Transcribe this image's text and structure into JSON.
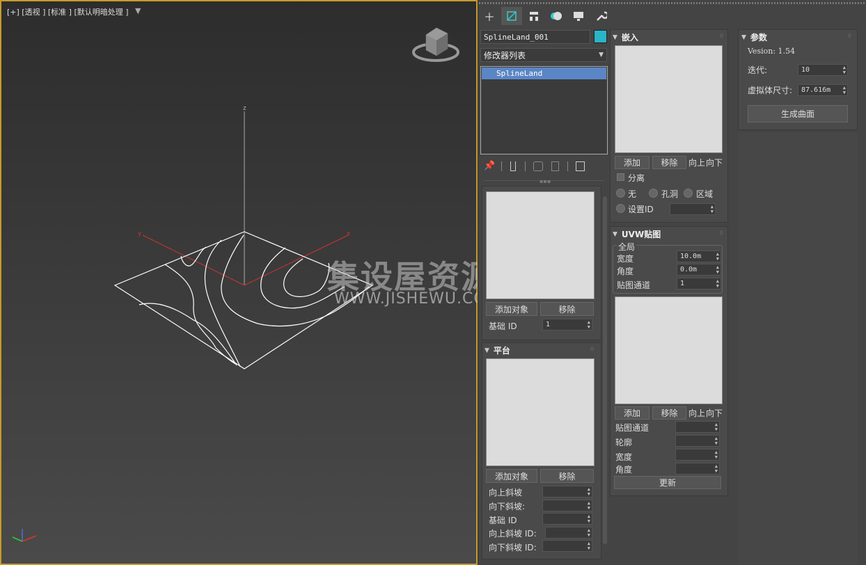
{
  "viewport": {
    "label": "[+] [透视 ] [标准 ] [默认明暗处理 ]",
    "axis_z": "z",
    "axis_x": "x",
    "axis_y": "y",
    "watermark_cn": "集设屋资源网",
    "watermark_en": "WWW.JISHEWU.COM"
  },
  "panel": {
    "object_name": "SplineLand_001",
    "object_color": "#2ab4c8",
    "modifier_dropdown": "修改器列表",
    "modifier_stack": [
      "SplineLand"
    ],
    "tabs": [
      "create-tab",
      "modify-tab",
      "hierarchy-tab",
      "motion-tab",
      "display-tab",
      "utilities-tab"
    ]
  },
  "left_col": {
    "add_object": "添加对象",
    "remove": "移除",
    "base_id_label": "基础 ID",
    "base_id_value": "1"
  },
  "platform": {
    "title": "平台",
    "add_object": "添加对象",
    "remove": "移除",
    "rows": [
      "向上斜坡",
      "向下斜坡:",
      "基础 ID",
      "向上斜坡 ID:",
      "向下斜坡 ID:"
    ]
  },
  "embed": {
    "title": "嵌入",
    "add": "添加",
    "remove": "移除",
    "up": "向上",
    "down": "向下",
    "separate": "分离",
    "none": "无",
    "hole": "孔洞",
    "region": "区域",
    "set_id": "设置ID"
  },
  "uvw": {
    "title": "UVW贴图",
    "global": "全局",
    "width_label": "宽度",
    "width_value": "10.0m",
    "angle_label": "角度",
    "angle_value": "0.0m",
    "channel_label": "贴图通道",
    "channel_value": "1",
    "add": "添加",
    "remove": "移除",
    "up": "向上",
    "down": "向下",
    "rows": [
      "贴图通道",
      "轮廓",
      "宽度",
      "角度"
    ],
    "update": "更新"
  },
  "params": {
    "title": "参数",
    "version": "Vesion: 1.54",
    "iter_label": "迭代:",
    "iter_value": "10",
    "proxy_label": "虚拟体尺寸:",
    "proxy_value": "87.616m",
    "generate": "生成曲面"
  }
}
